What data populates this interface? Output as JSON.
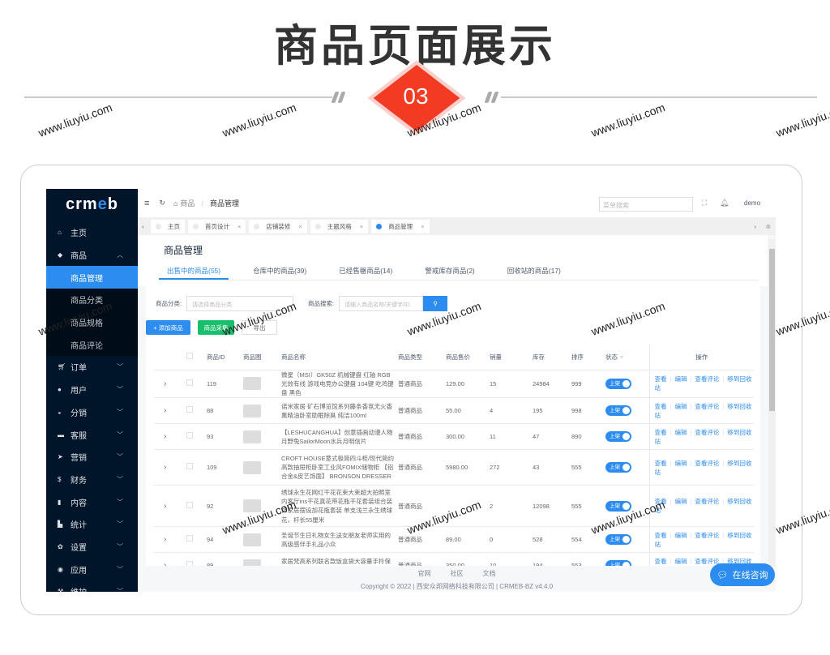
{
  "hero": {
    "title": "商品页面展示",
    "number": "03"
  },
  "watermark": "www.liuyiu.com",
  "sidebar": {
    "logo_a": "crm",
    "logo_b": "e",
    "logo_c": "b",
    "items": [
      {
        "label": "主页",
        "icon": "home-icon"
      },
      {
        "label": "商品",
        "icon": "goods-icon",
        "open": true
      }
    ],
    "sub": [
      "商品管理",
      "商品分类",
      "商品规格",
      "商品评论"
    ],
    "rest": [
      {
        "label": "订单",
        "icon": "cart-icon"
      },
      {
        "label": "用户",
        "icon": "user-icon"
      },
      {
        "label": "分销",
        "icon": "distribution-icon"
      },
      {
        "label": "客服",
        "icon": "chat-icon"
      },
      {
        "label": "营销",
        "icon": "send-icon"
      },
      {
        "label": "财务",
        "icon": "dollar-icon"
      },
      {
        "label": "内容",
        "icon": "book-icon"
      },
      {
        "label": "统计",
        "icon": "chart-icon"
      },
      {
        "label": "设置",
        "icon": "gear-icon"
      },
      {
        "label": "应用",
        "icon": "app-icon"
      },
      {
        "label": "维护",
        "icon": "hammer-icon"
      }
    ]
  },
  "header": {
    "crumb1": "商品",
    "crumb2": "商品管理",
    "search_placeholder": "菜单搜索",
    "user": "demo"
  },
  "tabs": [
    {
      "label": "主页"
    },
    {
      "label": "首页设计"
    },
    {
      "label": "店铺装修"
    },
    {
      "label": "主题风格"
    },
    {
      "label": "商品管理",
      "active": true
    }
  ],
  "page": {
    "title": "商品管理",
    "tabs": [
      "出售中的商品(55)",
      "仓库中的商品(39)",
      "已经售罄商品(14)",
      "警戒库存商品(2)",
      "回收站的商品(17)"
    ],
    "filter_category_label": "商品分类:",
    "filter_category_placeholder": "请选择商品分类",
    "filter_search_label": "商品搜索:",
    "filter_search_placeholder": "请输入商品名称/关键字/ID",
    "add_button": "+ 添加商品",
    "collect_button": "商品采集",
    "export_button": "导出"
  },
  "table": {
    "columns": [
      "商品ID",
      "商品图",
      "商品名称",
      "商品类型",
      "商品售价",
      "销量",
      "库存",
      "排序",
      "状态",
      "操作"
    ],
    "status_label": "上架",
    "actions": [
      "查看",
      "编辑",
      "查看评论",
      "移到回收站"
    ],
    "rows": [
      {
        "id": "119",
        "name": "微星（MSI）GK50Z 机械键盘 红轴 RGB光效有线 游戏电竞办公键盘 104键 吃鸡键盘 黑色",
        "type": "普通商品",
        "price": "129.00",
        "sales": "15",
        "stock": "24984",
        "sort": "999"
      },
      {
        "id": "88",
        "name": "诺米家居 矿石博览馆系列藤条香氛无火香薰精油卧室助眠除臭 纯洁100ml",
        "type": "普通商品",
        "price": "55.00",
        "sales": "4",
        "stock": "195",
        "sort": "998"
      },
      {
        "id": "93",
        "name": "【LESHUCANGHUA】创意插画动漫人物月野兔SailorMoon水兵月明信片",
        "type": "普通商品",
        "price": "300.00",
        "sales": "11",
        "stock": "47",
        "sort": "890"
      },
      {
        "id": "109",
        "name": "CROFT HOUSE意式极简四斗柜/现代简约高款抽屉柜卧室工业风FOMIX储物柜 【铝合金&皮艺饰面】 BRONSON DRESSER",
        "type": "普通商品",
        "price": "5980.00",
        "sales": "272",
        "stock": "43",
        "sort": "555"
      },
      {
        "id": "92",
        "name": "绣球永生花网红干花花束大束超大拍照室内客厅ins干花真花带花瓶干花套装组合装饰家居摆设加花瓶套装 单支浅兰永生绣球花，杆长55厘米",
        "type": "普通商品",
        "price": "",
        "sales": "2",
        "stock": "12098",
        "sort": "555"
      },
      {
        "id": "94",
        "name": "圣诞节生日礼物女生送女朋友老师实用的高级感伴手礼品小众",
        "type": "普通商品",
        "price": "89.00",
        "sales": "0",
        "stock": "528",
        "sort": "554"
      },
      {
        "id": "89",
        "name": "家居梵高系列联名款饭盒袋大容量手拎保温实",
        "type": "普通商品",
        "price": "350.00",
        "sales": "10",
        "stock": "194",
        "sort": "553"
      }
    ]
  },
  "footer": {
    "links": [
      "官网",
      "社区",
      "文档"
    ],
    "copyright": "Copyright © 2022 | 西安众邦网络科技有限公司 | CRMEB-BZ v4.4.0"
  },
  "chat_button": "在线咨询",
  "colors": {
    "accent": "#2d8cf0",
    "sidebar": "#001529",
    "hero_badge": "#f33a22",
    "collect": "#19be6b"
  }
}
